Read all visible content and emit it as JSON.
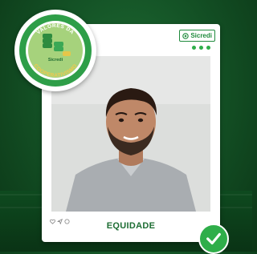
{
  "brand": {
    "name": "Sicredi"
  },
  "seal": {
    "top_text": "VALORES DA",
    "center_text": "Sicredi",
    "bottom_text": "COOPERATIVISMO"
  },
  "post": {
    "caption": "EQUIDADE",
    "menu_icon": "three-dots-icon"
  },
  "social_icons": [
    "heart-icon",
    "share-icon",
    "comment-icon"
  ],
  "badge": {
    "icon": "checkmark-icon"
  },
  "colors": {
    "brand_green": "#1f8a3c",
    "accent_green": "#2fae4a",
    "caption_green": "#1d6d33",
    "background": "#145326"
  }
}
